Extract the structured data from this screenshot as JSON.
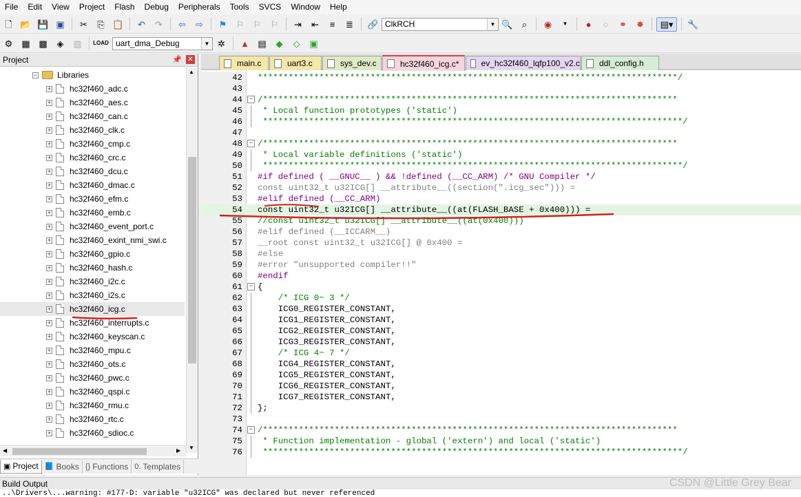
{
  "menu": [
    "File",
    "Edit",
    "View",
    "Project",
    "Flash",
    "Debug",
    "Peripherals",
    "Tools",
    "SVCS",
    "Window",
    "Help"
  ],
  "toolbar1": {
    "target_combo": "ClkRCH"
  },
  "toolbar2": {
    "build_target": "uart_dma_Debug"
  },
  "project": {
    "title": "Project",
    "folder": "Libraries",
    "files": [
      "hc32f460_adc.c",
      "hc32f460_aes.c",
      "hc32f460_can.c",
      "hc32f460_clk.c",
      "hc32f460_cmp.c",
      "hc32f460_crc.c",
      "hc32f460_dcu.c",
      "hc32f460_dmac.c",
      "hc32f460_efm.c",
      "hc32f460_emb.c",
      "hc32f460_event_port.c",
      "hc32f460_exint_nmi_swi.c",
      "hc32f460_gpio.c",
      "hc32f460_hash.c",
      "hc32f460_i2c.c",
      "hc32f460_i2s.c",
      "hc32f460_icg.c",
      "hc32f460_interrupts.c",
      "hc32f460_keyscan.c",
      "hc32f460_mpu.c",
      "hc32f460_ots.c",
      "hc32f460_pwc.c",
      "hc32f460_qspi.c",
      "hc32f460_rmu.c",
      "hc32f460_rtc.c",
      "hc32f460_sdioc.c"
    ],
    "selected": "hc32f460_icg.c"
  },
  "panel_tabs": [
    {
      "label": "Project",
      "icon": "project-icon"
    },
    {
      "label": "Books",
      "icon": "books-icon"
    },
    {
      "label": "Functions",
      "icon": "functions-icon"
    },
    {
      "label": "Templates",
      "icon": "templates-icon"
    }
  ],
  "file_tabs": [
    {
      "label": "main.c",
      "color": "#f4e7a8"
    },
    {
      "label": "uart3.c",
      "color": "#f4e7a8"
    },
    {
      "label": "sys_dev.c",
      "color": "#dfe9c6"
    },
    {
      "label": "hc32f460_icg.c*",
      "color": "#f6d6dc"
    },
    {
      "label": "ev_hc32f460_lqfp100_v2.c",
      "color": "#e4d6f0"
    },
    {
      "label": "ddl_config.h",
      "color": "#d6ecd6"
    }
  ],
  "code": [
    {
      "n": "42",
      "t": "**********************************************************************************/",
      "cls": "c-green",
      "fold": ""
    },
    {
      "n": "43",
      "t": "",
      "cls": "c-black",
      "fold": ""
    },
    {
      "n": "44",
      "t": "/*********************************************************************************",
      "cls": "c-green",
      "fold": "box"
    },
    {
      "n": "45",
      "t": " * Local function prototypes ('static')",
      "cls": "c-green",
      "fold": "line"
    },
    {
      "n": "46",
      "t": " **********************************************************************************/",
      "cls": "c-green",
      "fold": "line"
    },
    {
      "n": "47",
      "t": "",
      "cls": "c-black",
      "fold": ""
    },
    {
      "n": "48",
      "t": "/*********************************************************************************",
      "cls": "c-green",
      "fold": "box"
    },
    {
      "n": "49",
      "t": " * Local variable definitions ('static')",
      "cls": "c-green",
      "fold": "line"
    },
    {
      "n": "50",
      "t": " **********************************************************************************/",
      "cls": "c-green",
      "fold": "line"
    },
    {
      "n": "51",
      "t": "#if defined ( __GNUC__ ) && !defined (__CC_ARM) /* GNU Compiler */",
      "cls": "c-purple",
      "fold": ""
    },
    {
      "n": "52",
      "t": "const uint32_t u32ICG[] __attribute__((section(\".icg_sec\"))) =",
      "cls": "c-gray",
      "fold": ""
    },
    {
      "n": "53",
      "t": "#elif defined (__CC_ARM)",
      "cls": "c-purple",
      "fold": ""
    },
    {
      "n": "54",
      "t": "const uint32_t u32ICG[] __attribute__((at(FLASH_BASE + 0x400))) =",
      "cls": "c-black",
      "fold": "",
      "hl": true
    },
    {
      "n": "55",
      "t": "//const uint32_t u32ICG[] __attribute__((at(0x400)))",
      "cls": "c-green",
      "fold": ""
    },
    {
      "n": "56",
      "t": "#elif defined (__ICCARM__)",
      "cls": "c-gray",
      "fold": ""
    },
    {
      "n": "57",
      "t": "__root const uint32_t u32ICG[] @ 0x400 =",
      "cls": "c-gray",
      "fold": ""
    },
    {
      "n": "58",
      "t": "#else",
      "cls": "c-gray",
      "fold": ""
    },
    {
      "n": "59",
      "t": "#error \"unsupported compiler!!\"",
      "cls": "c-gray",
      "fold": ""
    },
    {
      "n": "60",
      "t": "#endif",
      "cls": "c-purple",
      "fold": ""
    },
    {
      "n": "61",
      "t": "{",
      "cls": "c-black",
      "fold": "box"
    },
    {
      "n": "62",
      "t": "    /* ICG 0~ 3 */",
      "cls": "c-green",
      "fold": "line"
    },
    {
      "n": "63",
      "t": "    ICG0_REGISTER_CONSTANT,",
      "cls": "c-black",
      "fold": "line"
    },
    {
      "n": "64",
      "t": "    ICG1_REGISTER_CONSTANT,",
      "cls": "c-black",
      "fold": "line"
    },
    {
      "n": "65",
      "t": "    ICG2_REGISTER_CONSTANT,",
      "cls": "c-black",
      "fold": "line"
    },
    {
      "n": "66",
      "t": "    ICG3_REGISTER_CONSTANT,",
      "cls": "c-black",
      "fold": "line"
    },
    {
      "n": "67",
      "t": "    /* ICG 4~ 7 */",
      "cls": "c-green",
      "fold": "line"
    },
    {
      "n": "68",
      "t": "    ICG4_REGISTER_CONSTANT,",
      "cls": "c-black",
      "fold": "line"
    },
    {
      "n": "69",
      "t": "    ICG5_REGISTER_CONSTANT,",
      "cls": "c-black",
      "fold": "line"
    },
    {
      "n": "70",
      "t": "    ICG6_REGISTER_CONSTANT,",
      "cls": "c-black",
      "fold": "line"
    },
    {
      "n": "71",
      "t": "    ICG7_REGISTER_CONSTANT,",
      "cls": "c-black",
      "fold": "line"
    },
    {
      "n": "72",
      "t": "};",
      "cls": "c-black",
      "fold": "line"
    },
    {
      "n": "73",
      "t": "",
      "cls": "c-black",
      "fold": ""
    },
    {
      "n": "74",
      "t": "/*********************************************************************************",
      "cls": "c-green",
      "fold": "box"
    },
    {
      "n": "75",
      "t": " * Function implementation - global ('extern') and local ('static')",
      "cls": "c-green",
      "fold": "line"
    },
    {
      "n": "76",
      "t": " **********************************************************************************/",
      "cls": "c-green",
      "fold": "line"
    }
  ],
  "build_output": {
    "title": "Build Output",
    "text": "..\\Drivers\\...warning: #177-D: variable \"u32ICG\" was declared but never referenced"
  },
  "watermark": "CSDN @Little Grey Bear",
  "colors": {
    "annotation_red": "#d81e1e"
  }
}
